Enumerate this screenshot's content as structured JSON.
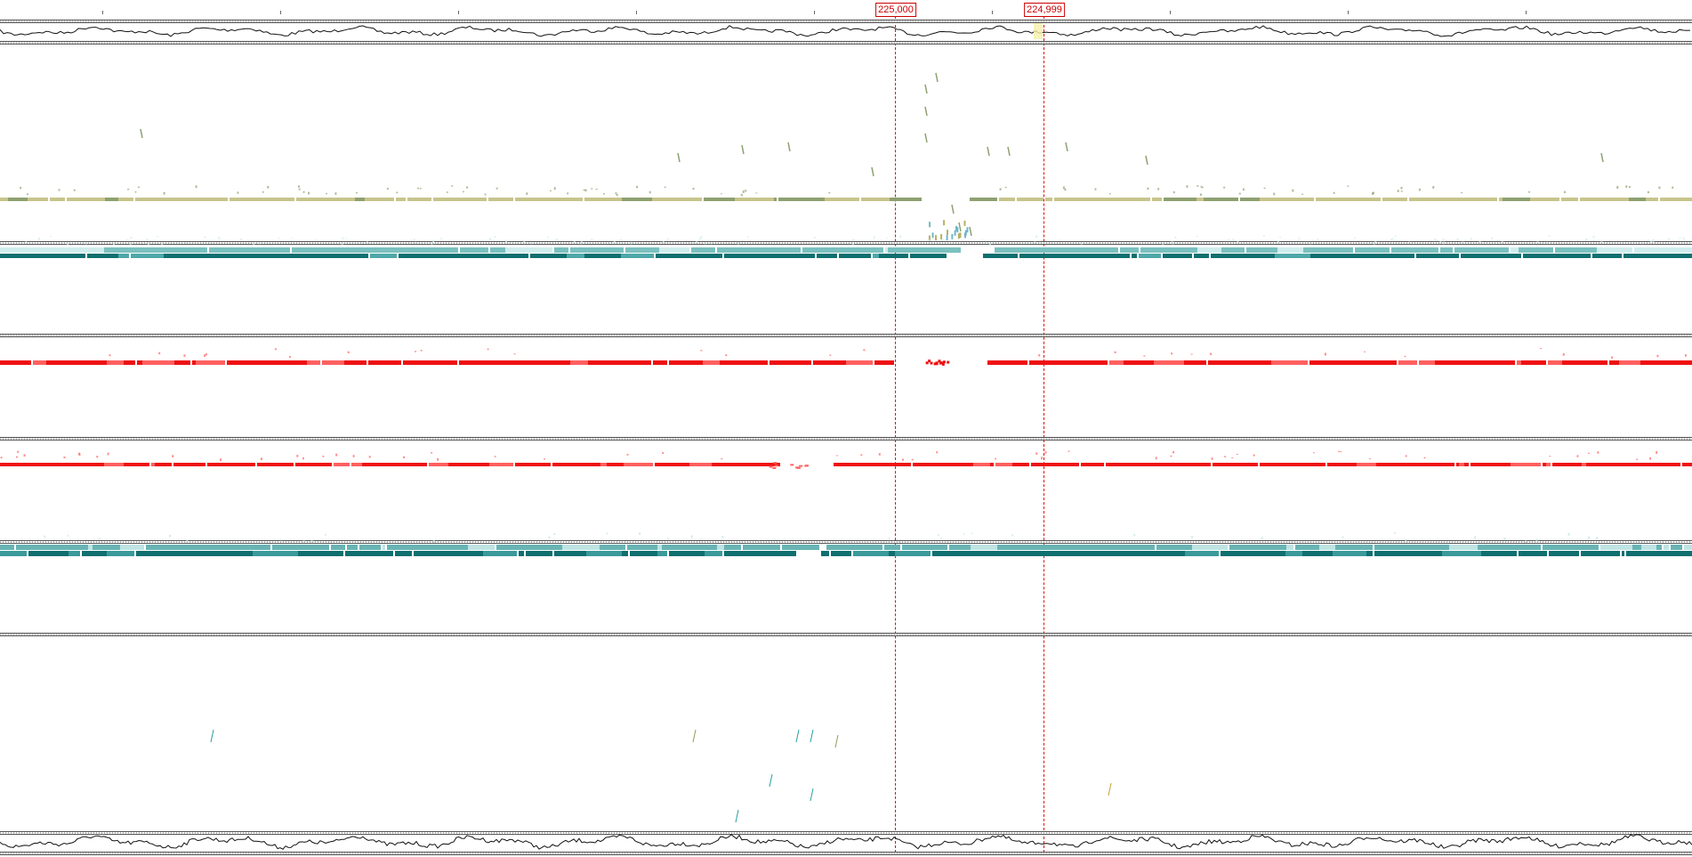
{
  "markers": [
    {
      "label": "225,000",
      "color": "#cc0000"
    },
    {
      "label": "224,999",
      "color": "#cc0000"
    }
  ],
  "tracks": [
    {
      "name": "olive-feature-track",
      "color": "#c8c48c",
      "accent": "#8ea070"
    },
    {
      "name": "teal-alignment-track-1",
      "color": "#3a9a9a",
      "accent": "#0f6f6f"
    },
    {
      "name": "red-alignment-track-1",
      "color": "#ee1111",
      "accent": "#ff6060"
    },
    {
      "name": "red-alignment-track-2",
      "color": "#ee1111",
      "accent": "#ff6060"
    },
    {
      "name": "teal-alignment-track-2",
      "color": "#3a9a9a",
      "accent": "#0f6f6f"
    },
    {
      "name": "sparse-feature-track",
      "color": "#2aa0a0",
      "accent": "#9a9a50"
    }
  ],
  "colors": {
    "profile": "#111111",
    "separator": "#555555",
    "marker": "#e01010"
  }
}
